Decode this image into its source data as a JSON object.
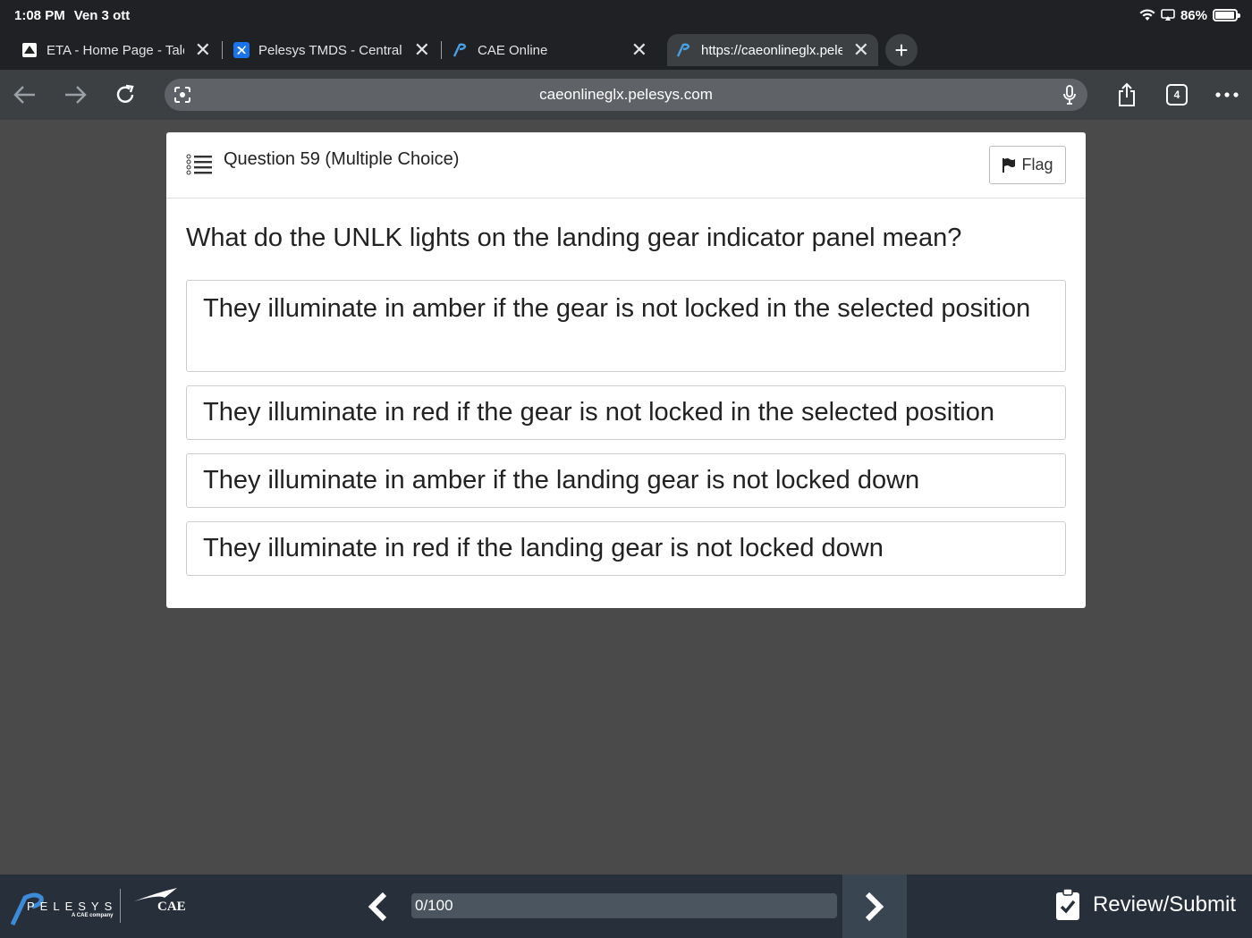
{
  "status": {
    "time": "1:08 PM",
    "date": "Ven 3 ott",
    "battery": "86%",
    "battery_level": 0.86
  },
  "tabs": [
    {
      "title": "ETA - Home Page - Talon",
      "active": false
    },
    {
      "title": "Pelesys TMDS - Central",
      "active": false
    },
    {
      "title": "CAE Online",
      "active": false
    },
    {
      "title": "https://caeonlineglx.pelesys.com",
      "active": true
    }
  ],
  "toolbar": {
    "url": "caeonlineglx.pelesys.com",
    "tab_count": "4"
  },
  "question": {
    "title": "Question 59 (Multiple Choice)",
    "flag_label": "Flag",
    "text": "What do the UNLK lights on the landing gear indicator panel mean?",
    "options": [
      "They illuminate in amber if the gear is not locked in the selected position",
      "They illuminate in red if the gear is not locked in the selected position",
      "They illuminate in amber if the landing gear is not locked down",
      "They illuminate in red if the landing gear is not locked down"
    ]
  },
  "footer": {
    "brand": "PELESYS",
    "brand_sub": "A CAE company",
    "partner": "CAE",
    "progress_text": "0/100",
    "progress_fraction": 0,
    "review_label": "Review/Submit"
  }
}
